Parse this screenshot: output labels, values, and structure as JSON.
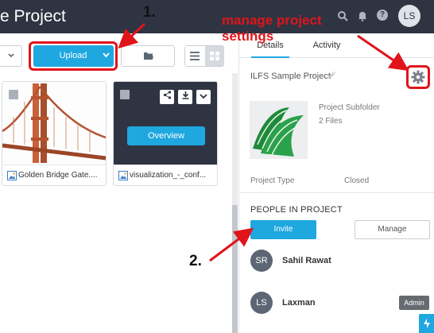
{
  "header": {
    "title": "e Project",
    "user_initials": "LS",
    "help_glyph": "?"
  },
  "toolbar": {
    "upload_label": "Upload"
  },
  "files": [
    {
      "name": "Golden Bridge Gate...."
    },
    {
      "name": "visualization_-_conf...",
      "overview_label": "Overview"
    }
  ],
  "panel": {
    "tabs": [
      {
        "label": "Details"
      },
      {
        "label": "Activity"
      }
    ],
    "project_name": "ILFS Sample Project",
    "subfolder_name": "Project Subfolder",
    "subfolder_files": "2 Files",
    "project_type_label": "Project Type",
    "project_type_value": "Closed",
    "people_heading": "PEOPLE IN PROJECT",
    "invite_label": "Invite",
    "manage_label": "Manage",
    "members": [
      {
        "initials": "SR",
        "name": "Sahil Rawat"
      },
      {
        "initials": "LS",
        "name": "Laxman",
        "badge": "Admin"
      }
    ]
  },
  "annotations": {
    "step1": "1.",
    "step2": "2.",
    "settings_note": "manage project settings"
  },
  "colors": {
    "topbar": "#2e3442",
    "accent": "#1fa7e0",
    "annotation_red": "#e0141b"
  },
  "icons": [
    "bell-icon",
    "help-icon",
    "folder-add-icon",
    "list-view-icon",
    "grid-view-icon",
    "share-icon",
    "download-icon",
    "chevron-down-icon",
    "pencil-icon",
    "gear-icon",
    "image-file-icon"
  ]
}
